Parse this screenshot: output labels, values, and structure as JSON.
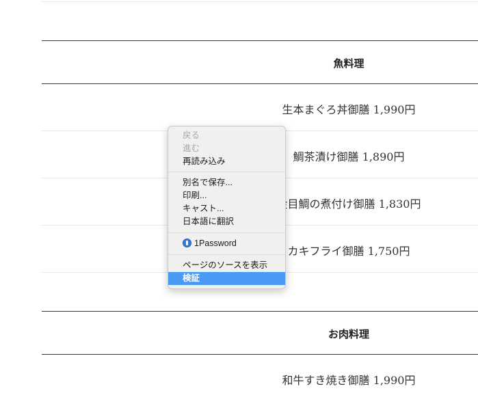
{
  "sections": {
    "fish": {
      "title": "魚料理",
      "items": [
        "生本まぐろ丼御膳 1,990円",
        "鯛茶漬け御膳 1,890円",
        "金目鯛の煮付け御膳 1,830円",
        "カキフライ御膳 1,750円"
      ]
    },
    "meat": {
      "title": "お肉料理",
      "items": [
        "和牛すき焼き御膳 1,990円"
      ]
    }
  },
  "context_menu": {
    "back": "戻る",
    "forward": "進む",
    "reload": "再読み込み",
    "save_as": "別名で保存...",
    "print": "印刷...",
    "cast": "キャスト...",
    "translate": "日本語に翻訳",
    "password_manager": "1Password",
    "view_source": "ページのソースを表示",
    "inspect": "検証",
    "selected_color": "#4a9af5"
  }
}
